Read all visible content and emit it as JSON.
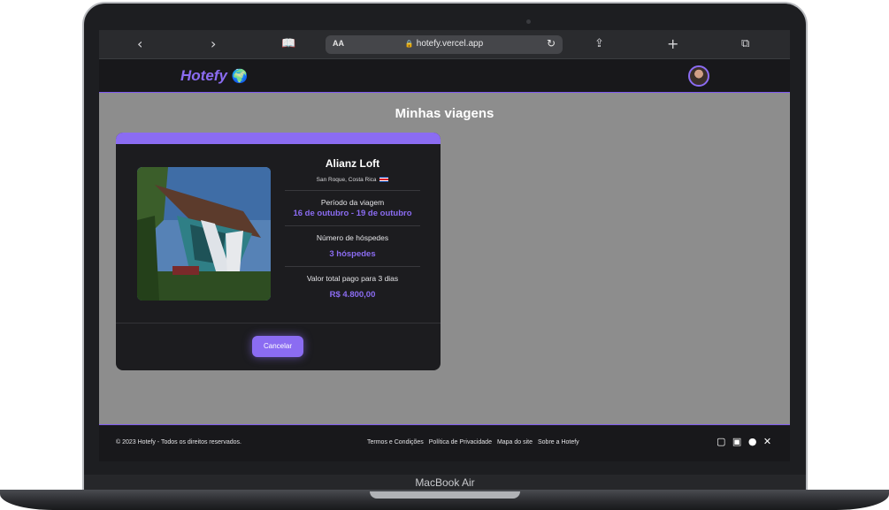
{
  "device": {
    "model_label": "MacBook Air"
  },
  "browser": {
    "url": "hotefy.vercel.app",
    "aa_label": "AA",
    "icons": [
      "back-icon",
      "forward-icon",
      "reader-icon",
      "lock-icon",
      "reload-icon",
      "share-icon",
      "new-tab-icon",
      "tabs-icon"
    ]
  },
  "header": {
    "logo": "Hotefy"
  },
  "main": {
    "title": "Minhas viagens",
    "trip": {
      "hotel_name": "Alianz Loft",
      "location": "San Roque, Costa Rica",
      "period_label": "Período da viagem",
      "start_date": "16 de outubro",
      "date_separator": "-",
      "end_date": "19 de outubro",
      "guests_label": "Número de hóspedes",
      "guests_value": "3 hóspedes",
      "total_label": "Valor total pago para 3 dias",
      "total_value": "R$ 4.800,00",
      "cancel_label": "Cancelar"
    }
  },
  "footer": {
    "copyright": "© 2023 Hotefy - Todos os direitos reservados.",
    "links": [
      "Termos e Condições",
      "Política de Privacidade",
      "Mapa do site",
      "Sobre a Hotefy"
    ],
    "social_icons": [
      "instagram-icon",
      "linkedin-icon",
      "github-icon",
      "x-icon"
    ]
  },
  "colors": {
    "accent": "#8b6cf2",
    "header_bg": "#18181b",
    "page_bg": "#8d8d8d",
    "card_bg": "#1c1c1f"
  }
}
